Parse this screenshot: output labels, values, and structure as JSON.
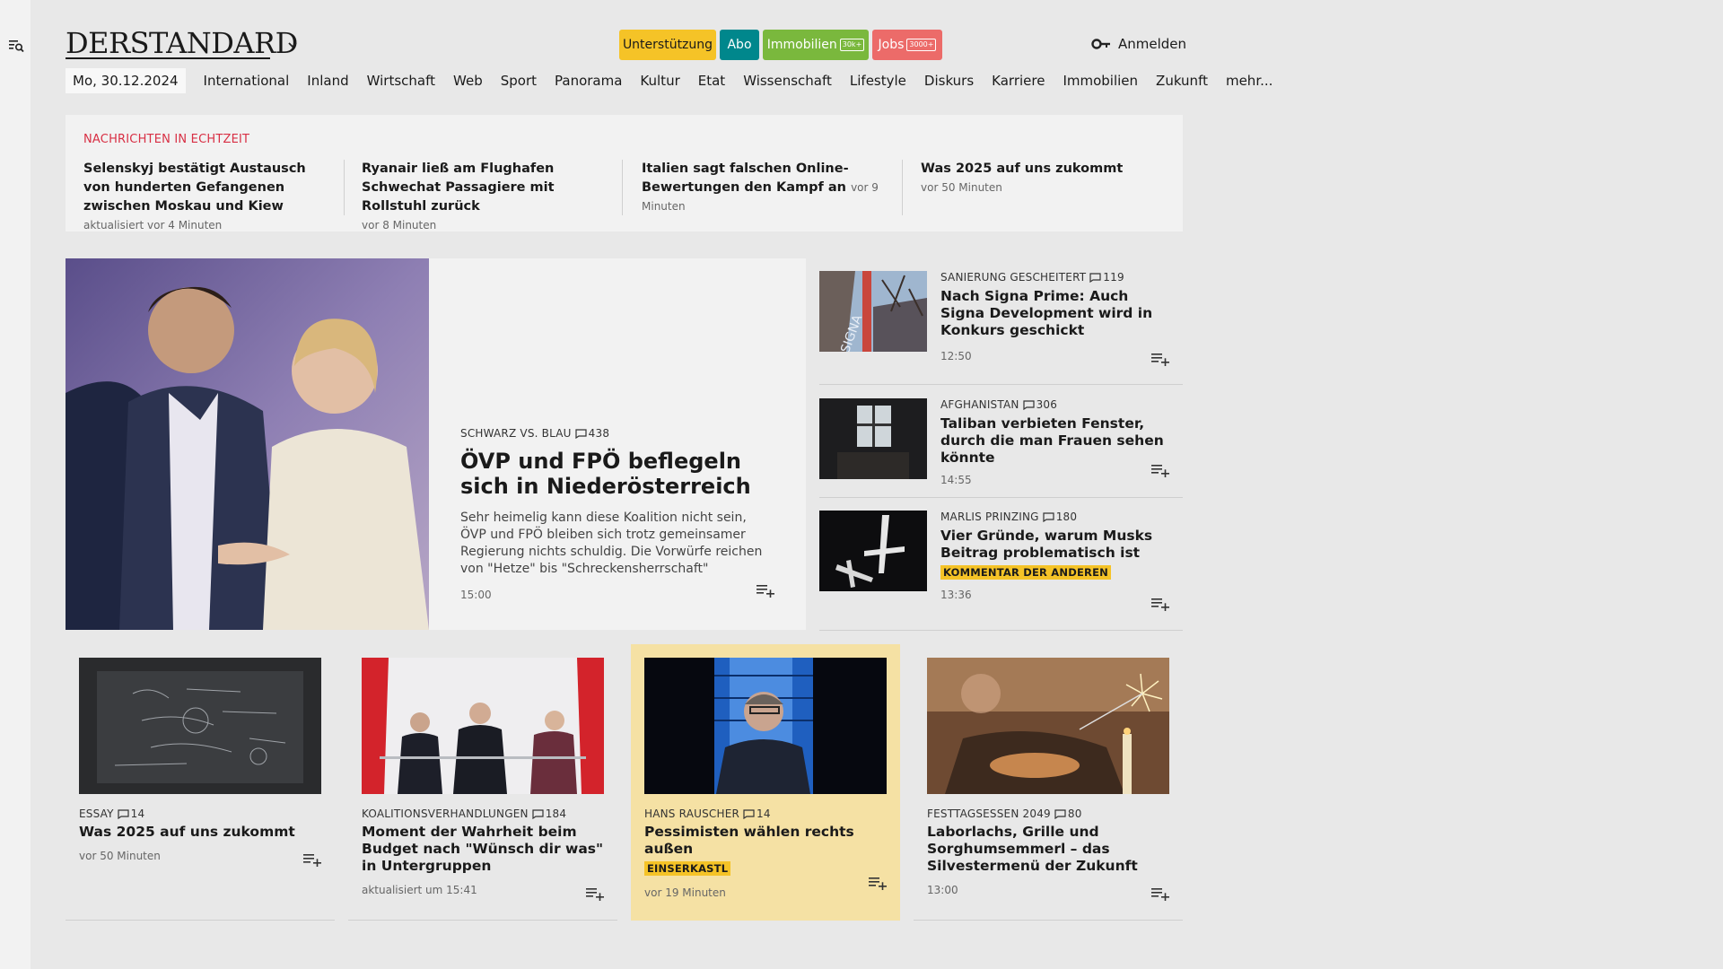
{
  "header": {
    "logo": "DERSTANDARD",
    "pills": {
      "support": "Unterstützung",
      "abo": "Abo",
      "immobilien": "Immobilien",
      "immobilien_badge": "30k+",
      "jobs": "Jobs",
      "jobs_badge": "3000+"
    },
    "login": "Anmelden",
    "date": "Mo, 30.12.2024",
    "nav": [
      "International",
      "Inland",
      "Wirtschaft",
      "Web",
      "Sport",
      "Panorama",
      "Kultur",
      "Etat",
      "Wissenschaft",
      "Lifestyle",
      "Diskurs",
      "Karriere",
      "Immobilien",
      "Zukunft",
      "mehr..."
    ]
  },
  "ticker": {
    "title": "NACHRICHTEN IN ECHTZEIT",
    "items": [
      {
        "headline": "Selenskyj bestätigt Austausch von hunderten Gefangenen zwischen Mos­kau und Kiew",
        "meta": "aktualisiert vor 4 Minuten"
      },
      {
        "headline": "Ryanair ließ am Flughafen Schwechat Passagiere mit Rollstuhl zurück",
        "meta": "vor 8 Minuten"
      },
      {
        "headline": "Italien sagt falschen Online-Bewer­tungen den Kampf an",
        "meta": "vor 9 Minuten"
      },
      {
        "headline": "Was 2025 auf uns zukommt",
        "meta": "vor 50 Minuten"
      }
    ]
  },
  "hero": {
    "kicker": "SCHWARZ VS. BLAU",
    "comments": "438",
    "title": "ÖVP und FPÖ beflegeln sich in Niederösterreich",
    "teaser": "Sehr heimelig kann diese Koalition nicht sein, ÖVP und FPÖ bleiben sich trotz gemeinsamer Regierung nichts schuldig. Die Vorwürfe reichen von \"Hetze\" bis \"Schreckensherrschaft\"",
    "time": "15:00"
  },
  "side_stories": [
    {
      "kicker": "SANIERUNG GESCHEITERT",
      "comments": "119",
      "title": "Nach Signa Prime: Auch Signa Development wird in Konkurs geschickt",
      "tag": "",
      "time": "12:50"
    },
    {
      "kicker": "AFGHANISTAN",
      "comments": "306",
      "title": "Taliban verbieten Fenster, durch die man Frauen sehen könnte",
      "tag": "",
      "time": "14:55"
    },
    {
      "kicker": "MARLIS PRINZING",
      "comments": "180",
      "title": "Vier Gründe, warum Musks Beitrag problematisch ist",
      "tag": "KOMMENTAR DER ANDEREN",
      "time": "13:36"
    }
  ],
  "cards": [
    {
      "kicker": "ESSAY",
      "comments": "14",
      "title": "Was 2025 auf uns zukommt",
      "tag": "",
      "time": "vor 50 Minuten"
    },
    {
      "kicker": "KOALITIONSVERHANDLUNGEN",
      "comments": "184",
      "title": "Moment der Wahrheit beim Budget nach \"Wünsch dir was\" in Untergruppen",
      "tag": "",
      "time": "aktualisiert um 15:41"
    },
    {
      "kicker": "HANS RAUSCHER",
      "comments": "14",
      "title": "Pessimisten wählen rechts außen",
      "tag": "EINSERKASTL",
      "time": "vor 19 Minuten"
    },
    {
      "kicker": "FESTTAGSESSEN 2049",
      "comments": "80",
      "title": "Laborlachs, Grille und Sorghumsemmerl – das Silvestermenü der Zukunft",
      "tag": "",
      "time": "13:00"
    }
  ],
  "colors": {
    "accent_red": "#d82f44",
    "yellow": "#f5c327",
    "teal": "#00878c",
    "green": "#7ab83d",
    "salmon": "#ec6b69"
  }
}
